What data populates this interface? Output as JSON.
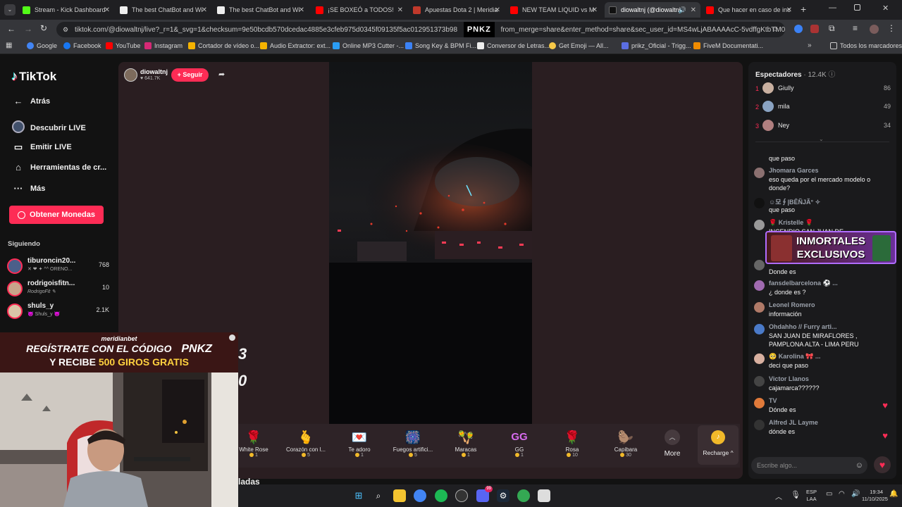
{
  "browser": {
    "tabs": [
      {
        "title": "Stream - Kick Dashboard",
        "color": "#53fc18"
      },
      {
        "title": "The best ChatBot and Wi",
        "color": "#eeeeee"
      },
      {
        "title": "The best ChatBot and Wi",
        "color": "#eeeeee"
      },
      {
        "title": "¡SE BOXEÓ a TODOS!",
        "color": "#ff0000"
      },
      {
        "title": "Apuestas Dota 2 | Meridia",
        "color": "#c0392b"
      },
      {
        "title": "NEW TEAM LIQUID vs M",
        "color": "#ff0000"
      },
      {
        "title": "diowaltnj (@diowaltnj",
        "color": "#111111"
      },
      {
        "title": "Que hacer en caso de inc",
        "color": "#ff0000"
      }
    ],
    "url": "tiktok.com/@diowaltnj/live?_r=1&_svg=1&checksum=9e50bcdb570dcedac4885e3cfeb975d0345f09135f5ac012951373b98",
    "url_tail": "from_merge=share&enter_method=share&sec_user_id=MS4wLjABAAAAcC-5vdffgKtbTM0u7f1oa...",
    "url_overlay": "PNKZ",
    "bookmarks": [
      "Google",
      "Facebook",
      "YouTube",
      "Instagram",
      "Cortador de vídeo o...",
      "Audio Extractor: ext...",
      "Online MP3 Cutter -...",
      "Song Key & BPM Fi...",
      "Conversor de Letras...",
      "Get Emoji — All...",
      "prikz_Oficial - Trigg...",
      "FiveM Documentati..."
    ],
    "bookmarks_folder": "Todos los marcadores"
  },
  "sidebar": {
    "logo": "TikTok",
    "nav": [
      {
        "label": "Atrás",
        "icon": "arrow-left-icon"
      },
      {
        "label": "Descubrir LIVE",
        "icon": "live-icon"
      },
      {
        "label": "Emitir LIVE",
        "icon": "camera-icon"
      },
      {
        "label": "Herramientas de cr...",
        "icon": "home-icon"
      },
      {
        "label": "Más",
        "icon": "more-icon"
      }
    ],
    "coins_button": "Obtener Monedas",
    "following_title": "Siguiendo",
    "following": [
      {
        "name": "tiburoncin20...",
        "sub": "✕ ❤ ✦ ^^ ORENO...",
        "count": "768"
      },
      {
        "name": "rodrigoisfitn...",
        "sub": "RodrigoFit ✎",
        "count": "10"
      },
      {
        "name": "shuls_y",
        "sub": "😈 Shuls_y 😈",
        "count": "2.1K"
      }
    ]
  },
  "streamer": {
    "name": "diowaltnj",
    "likes": "641.7K",
    "follow_label": "+ Seguir"
  },
  "overlay_left_digits": [
    "3",
    "0"
  ],
  "bottom_text": "ladas",
  "gifts": [
    {
      "name": "White Rose",
      "price": "1",
      "icon": "🌹"
    },
    {
      "name": "Corazón con l...",
      "price": "5",
      "icon": "🫰"
    },
    {
      "name": "Te adoro",
      "price": "1",
      "icon": "💌"
    },
    {
      "name": "Fuegos artifici...",
      "price": "5",
      "icon": "🎆"
    },
    {
      "name": "Maracas",
      "price": "1",
      "icon": "🪇"
    },
    {
      "name": "GG",
      "price": "1",
      "icon": "GG"
    },
    {
      "name": "Rosa",
      "price": "10",
      "icon": "🌹"
    },
    {
      "name": "Capibara",
      "price": "30",
      "icon": "🦫"
    }
  ],
  "gift_more": "More",
  "recharge": "Recharge",
  "chat": {
    "viewers_label": "Espectadores",
    "viewers_count": "12.4K",
    "top": [
      {
        "rank": "1",
        "name": "Giully",
        "score": "86"
      },
      {
        "rank": "2",
        "name": "mila",
        "score": "49"
      },
      {
        "rank": "3",
        "name": "Ney",
        "score": "34"
      }
    ],
    "messages": [
      {
        "user": "",
        "text": "que paso"
      },
      {
        "user": "Jhomara Garces",
        "text": "eso queda por el mercado modelo o donde?"
      },
      {
        "user": "☺모∮|BÊÑJÃ° ✧",
        "text": "que paso"
      },
      {
        "user": "🌹 Kristelle 🌹",
        "text": "INCENDIO SAN JUAN DE"
      },
      {
        "user": "",
        "text": "Donde es"
      },
      {
        "user": "fansdelbarcelona ⚽ ...",
        "text": "¿ donde es ?"
      },
      {
        "user": "Leonel Romero",
        "text": "información"
      },
      {
        "user": "Ohdahho // Furry arti...",
        "text": "SAN JUAN DE MIRAFLORES , PAMPLONA ALTA - LIMA PERU"
      },
      {
        "user": "🥺 Karolina 🎀 ...",
        "text": "deci que paso"
      },
      {
        "user": "Victor Llanos",
        "text": "cajamarca??????"
      },
      {
        "user": "TV",
        "text": "Dónde es"
      },
      {
        "user": "Alfred JL Layme",
        "text": "dónde es"
      }
    ],
    "input_placeholder": "Escribe algo...",
    "promo_line1": "INMORTALES",
    "promo_line2": "EXCLUSIVOS"
  },
  "sponsor": {
    "brand": "meridianbet",
    "line1": "REGÍSTRATE CON EL CÓDIGO",
    "code": "PNKZ",
    "line2a": "Y RECIBE",
    "line2b": "500 GIROS GRATIS"
  },
  "taskbar": {
    "lang1": "ESP",
    "lang2": "LAA",
    "time": "19:34",
    "date": "11/10/2025",
    "discord_badge": "99"
  }
}
